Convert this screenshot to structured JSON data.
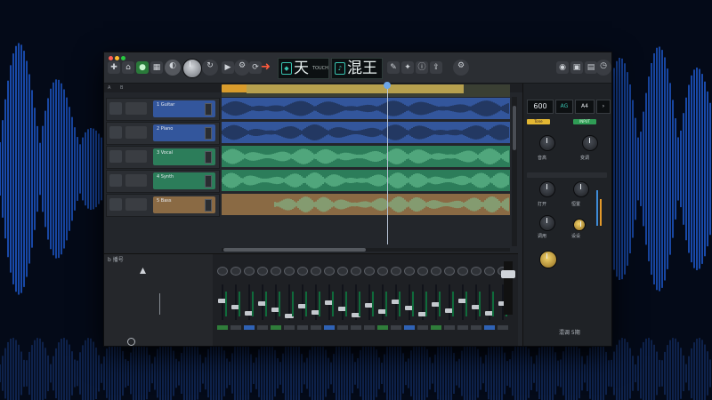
{
  "app": {
    "display_left": {
      "glyph": "天",
      "sub": "TOUCH"
    },
    "display_right": {
      "glyph": "混王"
    },
    "mixer_title": "b 播号",
    "right_panel": {
      "value": "600",
      "unit": "AG",
      "mode": "A4",
      "label1": "音高",
      "label2": "变调",
      "label3": "打开",
      "label4": "恒置",
      "label5": "调用",
      "label6": "设设",
      "footer": "混调 5期",
      "tag_gold": "Tone",
      "tag_green": "INPUT"
    },
    "tracks": [
      {
        "name": "1 Guitar",
        "color": "#3b5ea8"
      },
      {
        "name": "2 Piano",
        "color": "#3b5ea8"
      },
      {
        "name": "3 Vocal",
        "color": "#2f7d5d"
      },
      {
        "name": "4 Synth",
        "color": "#2f7d5d"
      },
      {
        "name": "5 Bass",
        "color": "#8a6a44"
      }
    ]
  },
  "colors": {
    "accent": "#38c3b0",
    "blue_track": "#33569c",
    "green_track": "#2c7d5a",
    "waveform_blue": "#2f6fe0"
  }
}
